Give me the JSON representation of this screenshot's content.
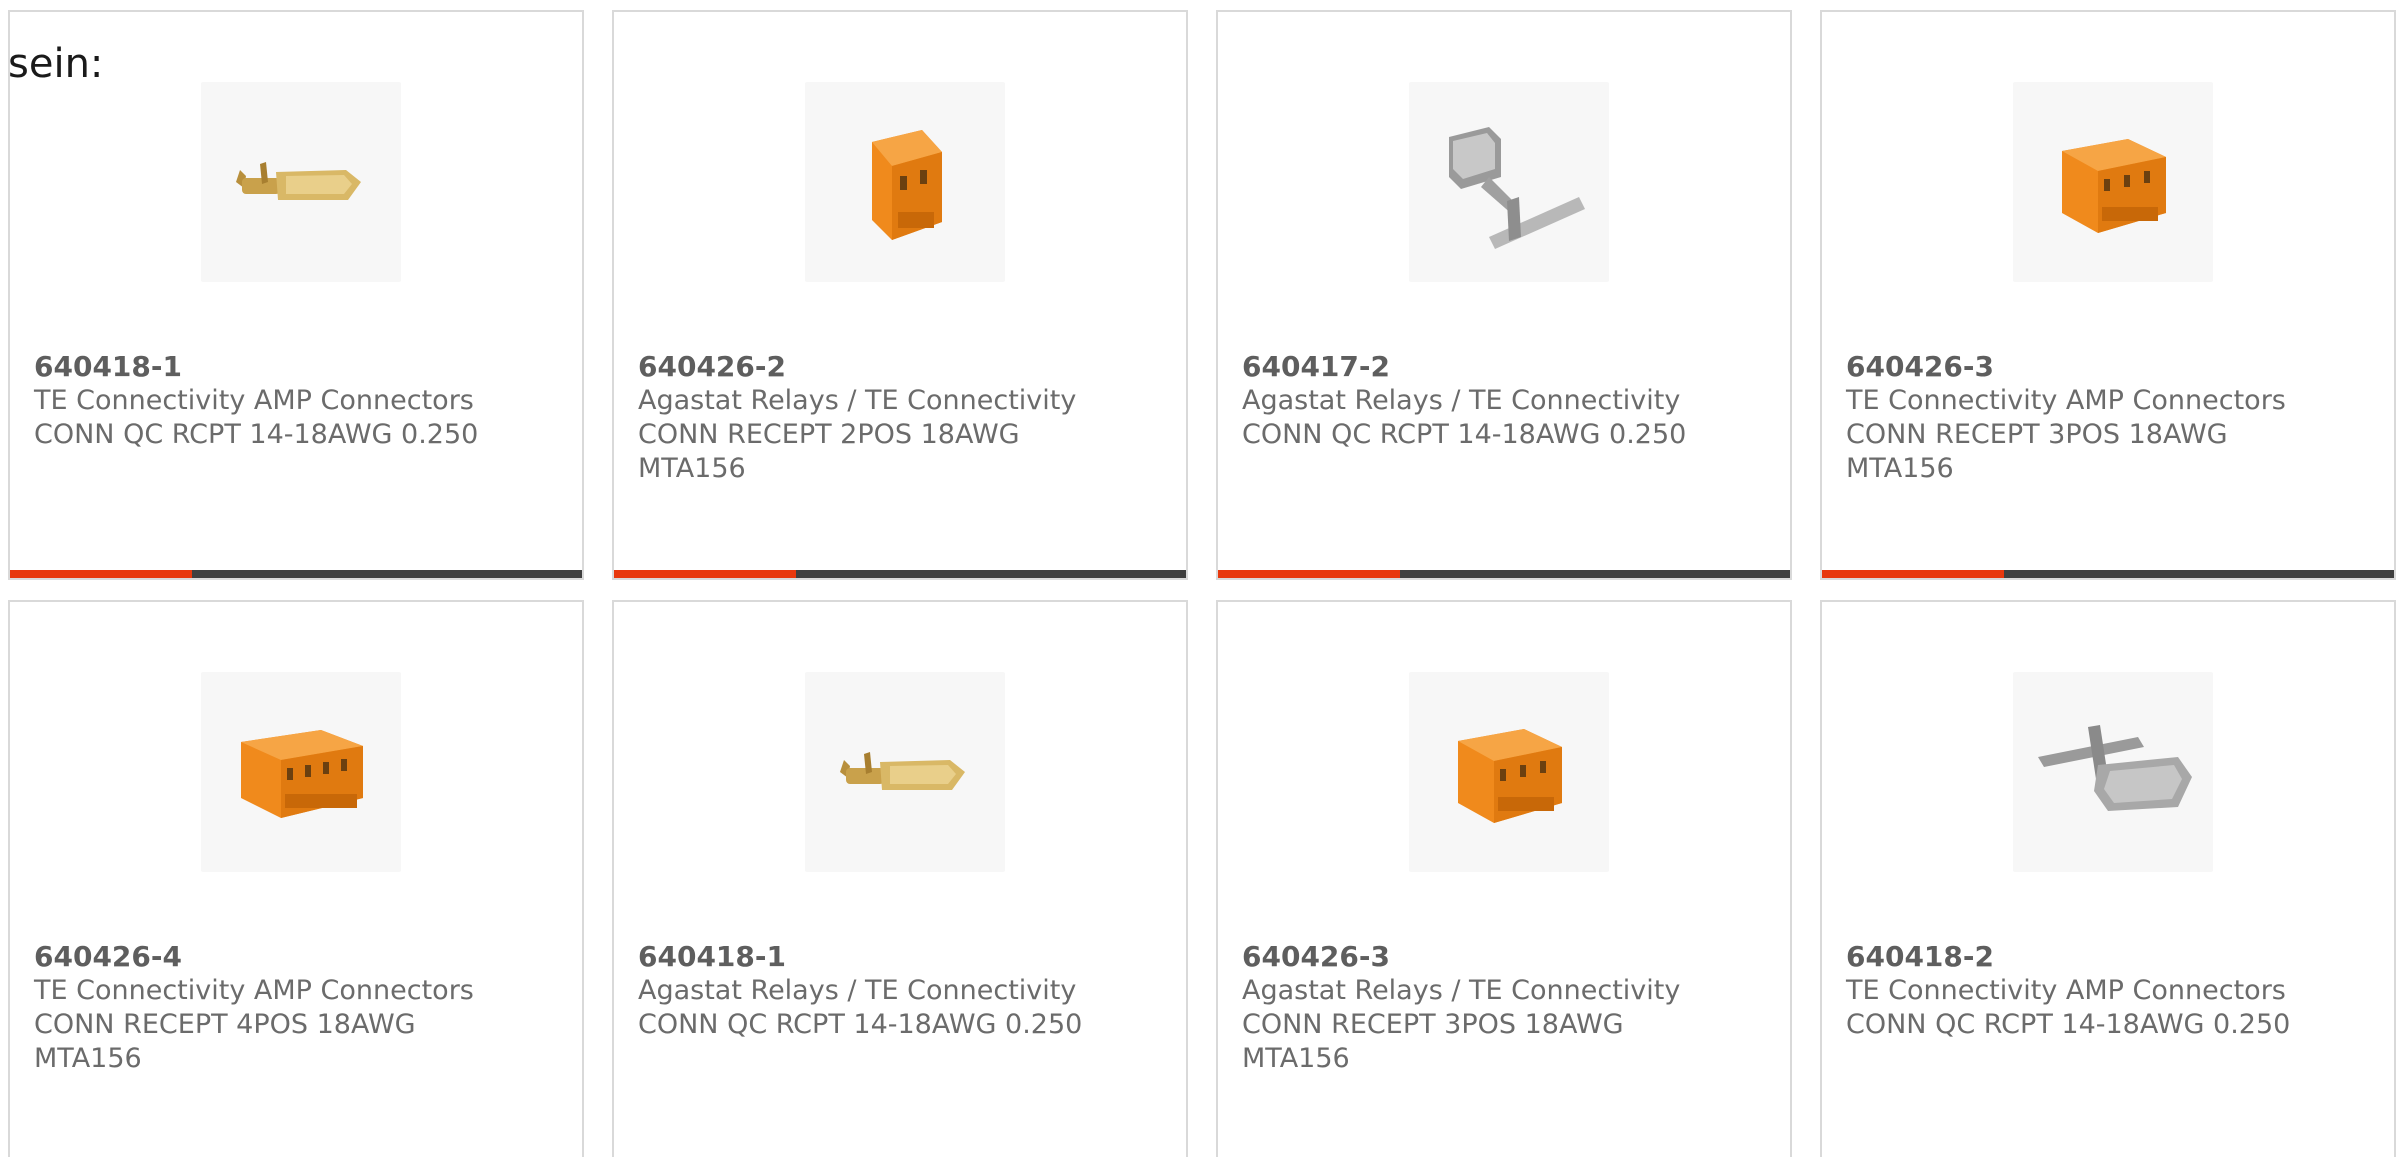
{
  "page": {
    "heading": "sein:"
  },
  "colors": {
    "accent": "#e8380d",
    "bar": "#3f3f3f",
    "border": "#d9d9d9",
    "text": "#6b6b6b"
  },
  "products": [
    {
      "part_number": "640418-1",
      "manufacturer": "TE Connectivity AMP Connectors",
      "description": "CONN QC RCPT 14-18AWG 0.250",
      "image": "brass-terminal-icon"
    },
    {
      "part_number": "640426-2",
      "manufacturer": "Agastat Relays / TE Connectivity",
      "description": "CONN RECEPT 2POS 18AWG MTA156",
      "image": "orange-housing-2pos-icon"
    },
    {
      "part_number": "640417-2",
      "manufacturer": "Agastat Relays / TE Connectivity",
      "description": "CONN QC RCPT 14-18AWG 0.250",
      "image": "steel-terminal-strip-icon"
    },
    {
      "part_number": "640426-3",
      "manufacturer": "TE Connectivity AMP Connectors",
      "description": "CONN RECEPT 3POS 18AWG MTA156",
      "image": "orange-housing-3pos-icon"
    },
    {
      "part_number": "640426-4",
      "manufacturer": "TE Connectivity AMP Connectors",
      "description": "CONN RECEPT 4POS 18AWG MTA156",
      "image": "orange-housing-4pos-icon"
    },
    {
      "part_number": "640418-1",
      "manufacturer": "Agastat Relays / TE Connectivity",
      "description": "CONN QC RCPT 14-18AWG 0.250",
      "image": "brass-terminal-icon"
    },
    {
      "part_number": "640426-3",
      "manufacturer": "Agastat Relays / TE Connectivity",
      "description": "CONN RECEPT 3POS 18AWG MTA156",
      "image": "orange-housing-3pos-icon"
    },
    {
      "part_number": "640418-2",
      "manufacturer": "TE Connectivity AMP Connectors",
      "description": "CONN QC RCPT 14-18AWG 0.250",
      "image": "steel-terminal-icon"
    }
  ]
}
